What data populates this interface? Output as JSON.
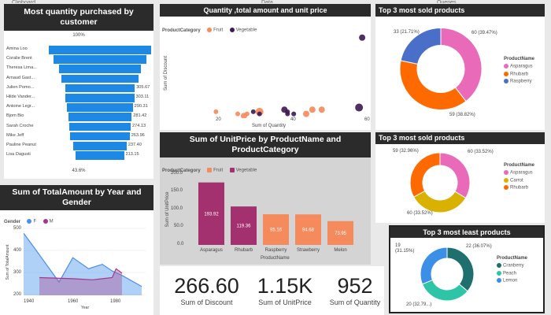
{
  "top_strip": {
    "left": "Clipboard",
    "middle": "Data",
    "right": "Queries"
  },
  "colors": {
    "title_bg": "#2b2b2b",
    "blue": "#1e88e5",
    "orange": "#f58a5c",
    "purple": "#3d1a4f",
    "magenta": "#a3306f",
    "pink": "#e96ab8"
  },
  "funnel": {
    "title": "Most quantity purchased by customer",
    "top_label": "100%",
    "bottom_label": "43.6%",
    "rows": [
      {
        "name": "Amina Loo",
        "value": "",
        "pct": 100
      },
      {
        "name": "Coralie Brent",
        "value": "",
        "pct": 91
      },
      {
        "name": "Theresa Lima...",
        "value": "",
        "pct": 80
      },
      {
        "name": "Arnaud Gast...",
        "value": "",
        "pct": 75
      },
      {
        "name": "Julien Pomo...",
        "value": "305.67",
        "pct": 68
      },
      {
        "name": "Hilde Vander...",
        "value": "303.11",
        "pct": 67
      },
      {
        "name": "Antoine Legr...",
        "value": "290.31",
        "pct": 64
      },
      {
        "name": "Bjom Bio",
        "value": "281.42",
        "pct": 62
      },
      {
        "name": "Sarah Croche",
        "value": "274.13",
        "pct": 60
      },
      {
        "name": "Mike Jeff",
        "value": "263.96",
        "pct": 58
      },
      {
        "name": "Pauline Peanut",
        "value": "237.40",
        "pct": 52
      },
      {
        "name": "Lisa Dagusti",
        "value": "213.15",
        "pct": 47
      }
    ]
  },
  "scatter": {
    "title": "Quantity ,total amount and unit price",
    "legend_title": "ProductCategory",
    "legend": [
      "Fruit",
      "Vegetable"
    ],
    "xlabel": "Sum of Quantity",
    "ylabel": "Sum of Discount",
    "xticks": [
      "20",
      "40",
      "60"
    ]
  },
  "bar": {
    "title": "Sum of UnitPrice by ProductName and ProductCategory",
    "legend_title": "ProductCategory",
    "legend": [
      "Fruit",
      "Vegetable"
    ],
    "xlabel": "ProductName",
    "ylabel": "Sum of UnitPrice",
    "yticks": [
      "200.0",
      "150.0",
      "100.0",
      "50.0",
      "0.0"
    ]
  },
  "line": {
    "title": "Sum of TotalAmount by Year and Gender",
    "legend_title": "Gender",
    "legend": [
      "F",
      "M"
    ],
    "xlabel": "Year",
    "ylabel": "Sum of TotalAmount",
    "yticks": [
      "500",
      "400",
      "300",
      "200"
    ],
    "xticks": [
      "1940",
      "1960",
      "1980"
    ]
  },
  "donut1": {
    "title": "Top 3 most sold products",
    "legend_title": "ProductName",
    "legend": [
      "Asparagus",
      "Rhubarb",
      "Raspberry"
    ],
    "labels": [
      "60 (39.47%)",
      "59 (38.82%)",
      "33 (21.71%)"
    ]
  },
  "donut2": {
    "title": "Top 3 most sold products",
    "legend_title": "ProductName",
    "legend": [
      "Asparagus",
      "Carrot",
      "Rhubarb"
    ],
    "labels": [
      "60 (33.52%)",
      "60 (33.52%)",
      "59 (32.96%)"
    ]
  },
  "donut3": {
    "title": "Top 3 most least products",
    "legend_title": "ProductName",
    "legend": [
      "Cranberry",
      "Peach",
      "Lemon"
    ],
    "labels": [
      "22 (36.07%)",
      "20 (32.79...)",
      "19 (31.15%)"
    ]
  },
  "kpis": [
    {
      "value": "266.60",
      "label": "Sum of Discount"
    },
    {
      "value": "1.15K",
      "label": "Sum of UnitPrice"
    },
    {
      "value": "952",
      "label": "Sum of Quantity"
    }
  ],
  "chart_data": [
    {
      "type": "bar",
      "title": "Sum of UnitPrice by ProductName and ProductCategory",
      "xlabel": "ProductName",
      "ylabel": "Sum of UnitPrice",
      "categories": [
        "Asparagus",
        "Rhubarb",
        "Raspberry",
        "Strawberry",
        "Melon"
      ],
      "values": [
        193.92,
        119.36,
        95.16,
        94.68,
        73.95
      ],
      "category_type": [
        "Vegetable",
        "Vegetable",
        "Fruit",
        "Fruit",
        "Fruit"
      ],
      "ylim": [
        0,
        220
      ]
    },
    {
      "type": "pie",
      "title": "Top 3 most sold products",
      "labels": [
        "Asparagus",
        "Rhubarb",
        "Raspberry"
      ],
      "values": [
        60,
        59,
        33
      ],
      "colors": [
        "#e96ab8",
        "#ff6a00",
        "#4a6fc9"
      ]
    },
    {
      "type": "pie",
      "title": "Top 3 most sold products",
      "labels": [
        "Asparagus",
        "Carrot",
        "Rhubarb"
      ],
      "values": [
        60,
        60,
        59
      ],
      "colors": [
        "#e96ab8",
        "#d9b100",
        "#ff6a00"
      ]
    },
    {
      "type": "pie",
      "title": "Top 3 most least products",
      "labels": [
        "Cranberry",
        "Peach",
        "Lemon"
      ],
      "values": [
        22,
        20,
        19
      ],
      "colors": [
        "#1f6f6f",
        "#2ec4a6",
        "#3b8fe6"
      ]
    },
    {
      "type": "area",
      "title": "Sum of TotalAmount by Year and Gender",
      "xlabel": "Year",
      "ylabel": "Sum of TotalAmount",
      "series": [
        {
          "name": "F",
          "x": [
            1935,
            1940,
            1953,
            1960,
            1968,
            1975,
            1980,
            1985,
            1995
          ],
          "y": [
            480,
            420,
            260,
            370,
            320,
            340,
            310,
            290,
            240
          ]
        },
        {
          "name": "M",
          "x": [
            1943,
            1960,
            1970,
            1980,
            1982,
            1985
          ],
          "y": [
            280,
            275,
            270,
            280,
            320,
            300
          ]
        }
      ],
      "xlim": [
        1935,
        1997
      ],
      "ylim": [
        200,
        520
      ]
    },
    {
      "type": "scatter",
      "title": "Quantity ,total amount and unit price",
      "xlabel": "Sum of Quantity",
      "ylabel": "Sum of Discount",
      "series": [
        {
          "name": "Fruit",
          "x": [
            13,
            20,
            22,
            23,
            27,
            42,
            44,
            47
          ],
          "y": [
            3,
            2,
            1,
            2,
            3,
            2,
            4,
            4
          ],
          "size": [
            3,
            3,
            4,
            3,
            5,
            4,
            4,
            4
          ]
        },
        {
          "name": "Vegetable",
          "x": [
            25,
            27,
            35,
            36,
            36,
            38,
            59,
            60
          ],
          "y": [
            3,
            2,
            4,
            3,
            2,
            2,
            5,
            38
          ],
          "size": [
            3,
            3,
            4,
            3,
            3,
            3,
            5,
            4
          ]
        }
      ],
      "xlim": [
        0,
        62
      ],
      "ylim": [
        0,
        42
      ]
    }
  ]
}
